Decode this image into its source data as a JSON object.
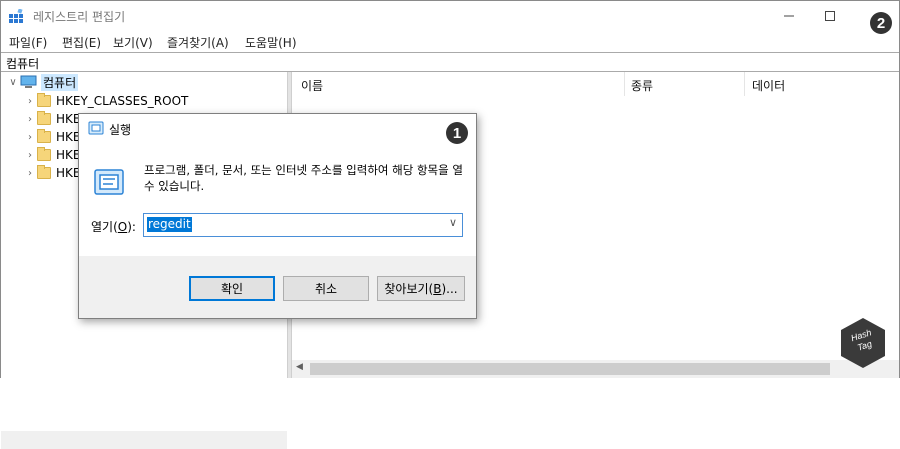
{
  "window": {
    "title": "레지스트리 편집기",
    "menu": [
      "파일(F)",
      "편집(E)",
      "보기(V)",
      "즐겨찾기(A)",
      "도움말(H)"
    ],
    "address": "컴퓨터"
  },
  "tree": {
    "root": "컴퓨터",
    "items": [
      "HKEY_CLASSES_ROOT",
      "HKE",
      "HKE",
      "HKE",
      "HKE"
    ]
  },
  "list": {
    "columns": [
      "이름",
      "종류",
      "데이터"
    ]
  },
  "run_dialog": {
    "title": "실행",
    "description": "프로그램, 폴더, 문서, 또는 인터넷 주소를 입력하여 해당 항목을 열 수 있습니다.",
    "open_label_pre": "열기(",
    "open_label_key": "O",
    "open_label_post": "):",
    "open_value": "regedit",
    "ok_label": "확인",
    "cancel_label": "취소",
    "browse_label_pre": "찾아보기(",
    "browse_label_key": "B",
    "browse_label_post": ")..."
  },
  "annotations": {
    "badge_1": "1",
    "badge_2": "2"
  },
  "watermark": "Hash Tag",
  "colors": {
    "accent": "#0078d7",
    "badge": "#333333"
  }
}
